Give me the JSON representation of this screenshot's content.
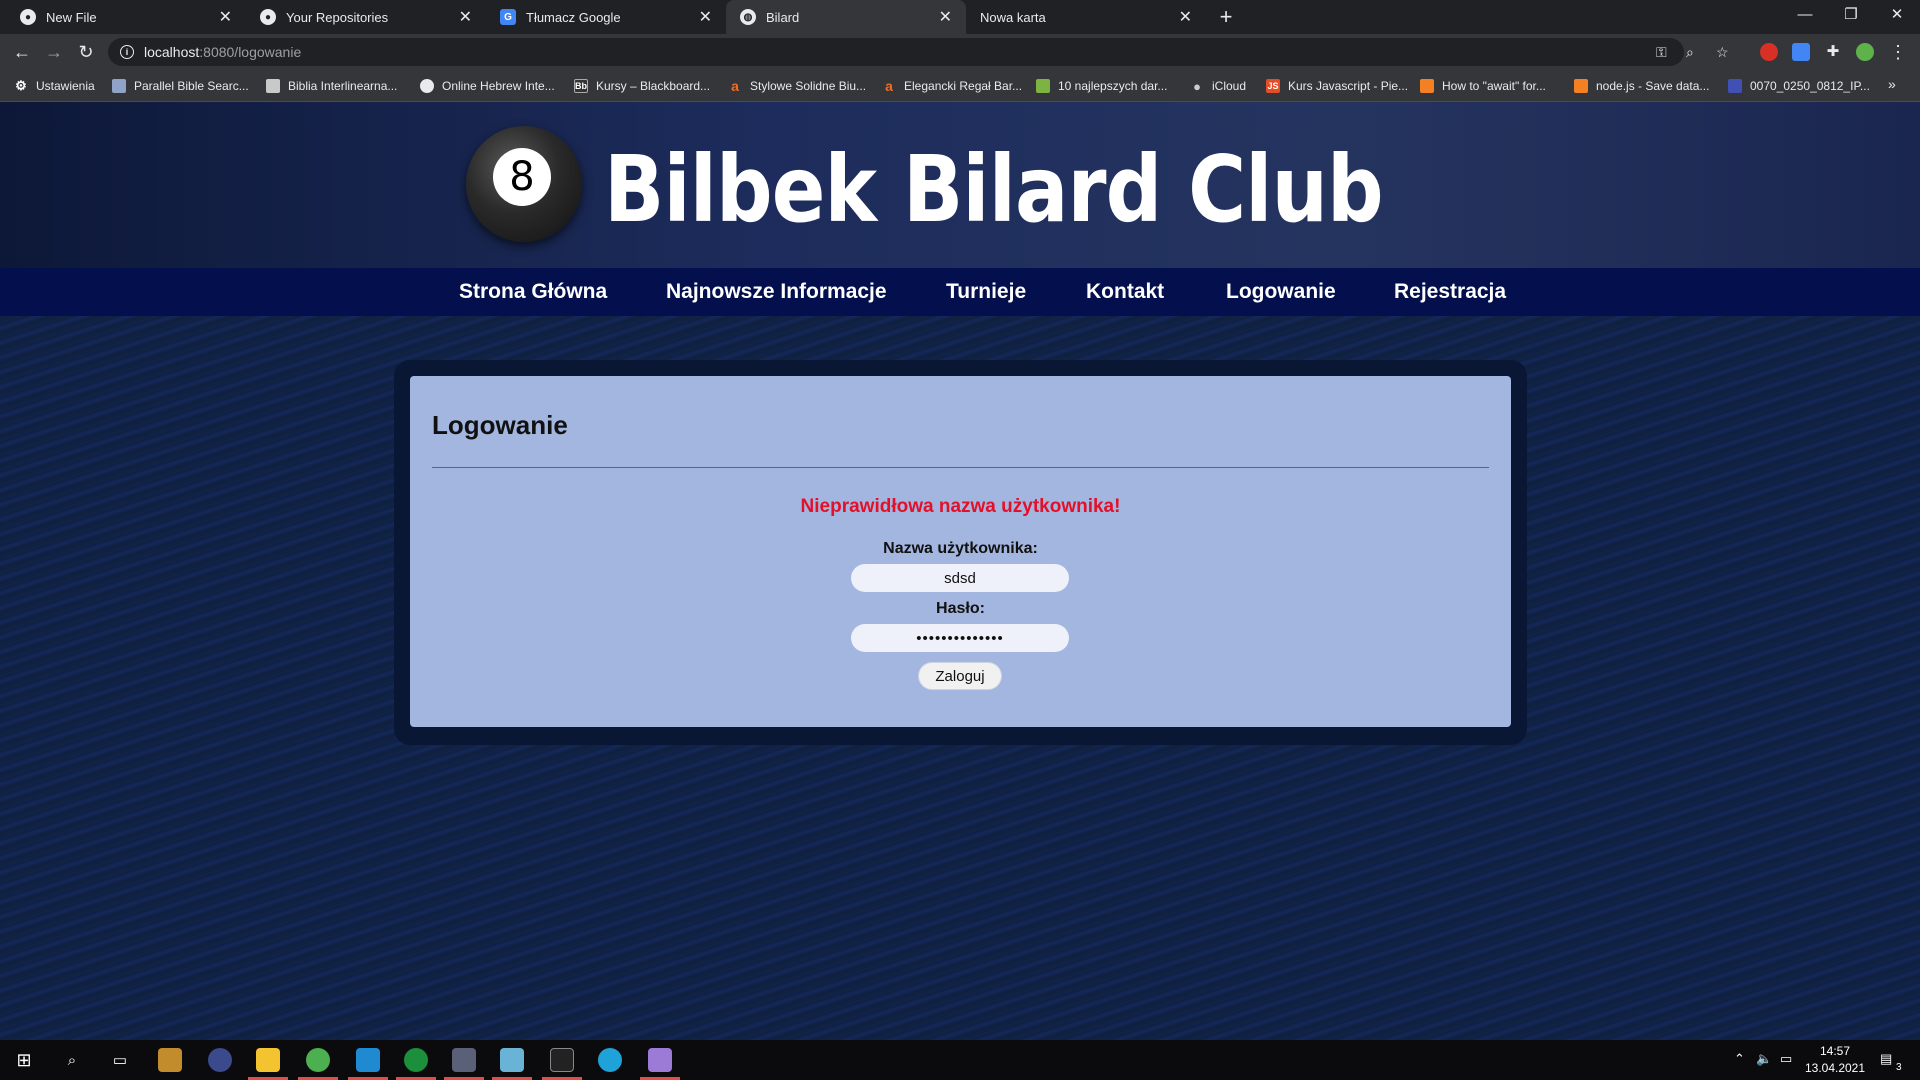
{
  "browser": {
    "tabs": [
      {
        "title": "New File",
        "icon": "github-icon"
      },
      {
        "title": "Your Repositories",
        "icon": "github-icon"
      },
      {
        "title": "Tłumacz Google",
        "icon": "google-translate-icon"
      },
      {
        "title": "Bilard",
        "icon": "globe-icon"
      },
      {
        "title": "Nowa karta",
        "icon": ""
      }
    ],
    "url_host": "localhost",
    "url_rest": ":8080/logowanie",
    "bookmarks": [
      "Ustawienia",
      "Parallel Bible Searc...",
      "Biblia Interlinearna...",
      "Online Hebrew Inte...",
      "Kursy – Blackboard...",
      "Stylowe Solidne Biu...",
      "Elegancki Regał Bar...",
      "10 najlepszych dar...",
      "iCloud",
      "Kurs Javascript - Pie...",
      "How to \"await\" for...",
      "node.js - Save data...",
      "0070_0250_0812_IP..."
    ]
  },
  "site": {
    "logo_number": "8",
    "title": "Bilbek Bilard Club",
    "nav": [
      "Strona Główna",
      "Najnowsze Informacje",
      "Turnieje",
      "Kontakt",
      "Logowanie",
      "Rejestracja"
    ]
  },
  "login": {
    "heading": "Logowanie",
    "error": "Nieprawidłowa nazwa użytkownika!",
    "username_label": "Nazwa użytkownika:",
    "username_value": "sdsd",
    "password_label": "Hasło:",
    "password_value": "••••••••••••••",
    "submit_label": "Zaloguj"
  },
  "taskbar": {
    "time": "14:57",
    "date": "13.04.2021",
    "notifications": "3"
  },
  "colors": {
    "error": "#e3102a",
    "nav_bg": "#04104e",
    "card_bg": "#a3b6e0"
  }
}
